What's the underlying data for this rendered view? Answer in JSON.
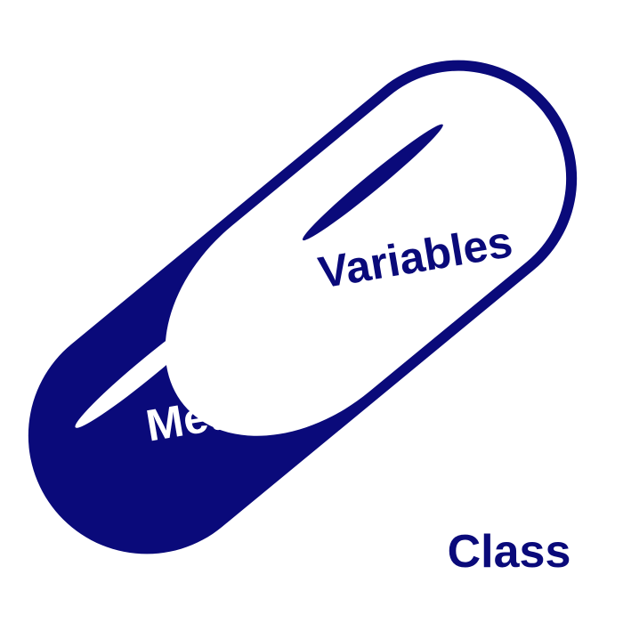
{
  "capsule": {
    "left_label": "Methods",
    "right_label": "Variables",
    "colors": {
      "dark": "#0a0a7a",
      "light": "#ffffff"
    }
  },
  "caption": {
    "text": "Class",
    "color": "#0a0a7a"
  }
}
